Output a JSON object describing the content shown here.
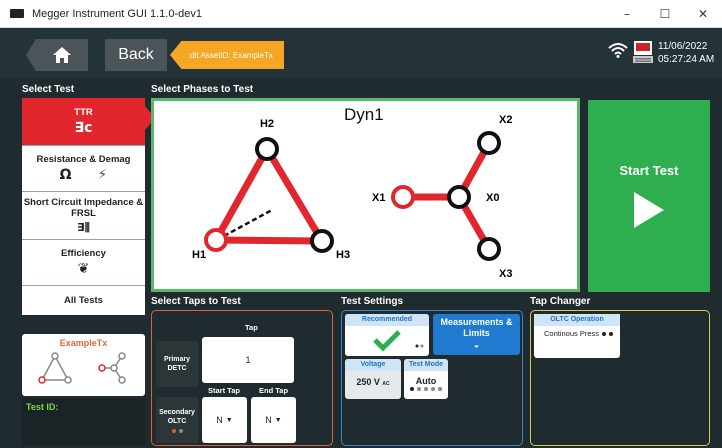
{
  "window": {
    "title": "Megger Instrument GUI 1.1.0-dev1",
    "minimize": "–",
    "maximize": "☐",
    "close": "✕"
  },
  "header": {
    "back_label": "Back",
    "asset_tag": ":dit AssetID: ExampleTx",
    "date": "11/06/2022",
    "time": "05:27:24 AM"
  },
  "sections": {
    "select_test": "Select Test",
    "select_phases": "Select Phases to Test",
    "select_taps": "Select Taps to Test",
    "test_settings": "Test Settings",
    "tap_changer": "Tap Changer"
  },
  "tests": [
    {
      "label": "TTR",
      "icon": "∃c",
      "active": true
    },
    {
      "label": "Resistance & Demag",
      "icon": "Ω",
      "icon2": "⚡"
    },
    {
      "label": "Short Circuit Impedance & FRSL",
      "icon": "∃⫼"
    },
    {
      "label": "Efficiency",
      "icon": "❦"
    },
    {
      "label": "All Tests"
    }
  ],
  "phases": {
    "vector_group": "Dyn1",
    "labels": {
      "h1": "H1",
      "h2": "H2",
      "h3": "H3",
      "x0": "X0",
      "x1": "X1",
      "x2": "X2",
      "x3": "X3"
    }
  },
  "start_button": {
    "label": "Start Test"
  },
  "asset_card": {
    "name": "ExampleTx"
  },
  "test_id": {
    "label": "Test ID:"
  },
  "taps": {
    "tap_header": "Tap",
    "start_header": "Start Tap",
    "end_header": "End Tap",
    "primary_label": "Primary",
    "primary_sub": "DETC",
    "primary_value": "1",
    "secondary_label": "Secondary",
    "secondary_sub": "OLTC",
    "start_value": "N",
    "end_value": "N"
  },
  "settings": {
    "recommended": "Recommended",
    "measurements": "Measurements & Limits",
    "voltage_label": "Voltage",
    "voltage_value": "250 V",
    "voltage_unit": "AC",
    "test_mode_label": "Test Mode",
    "test_mode_value": "Auto"
  },
  "tap_changer": {
    "oltc_label": "OLTC Operation",
    "oltc_value": "Continous Press"
  },
  "colors": {
    "accent_red": "#e1262d",
    "start_green": "#2fae4f",
    "settings_blue": "#1f7ad0",
    "tag_orange": "#f5a623"
  }
}
